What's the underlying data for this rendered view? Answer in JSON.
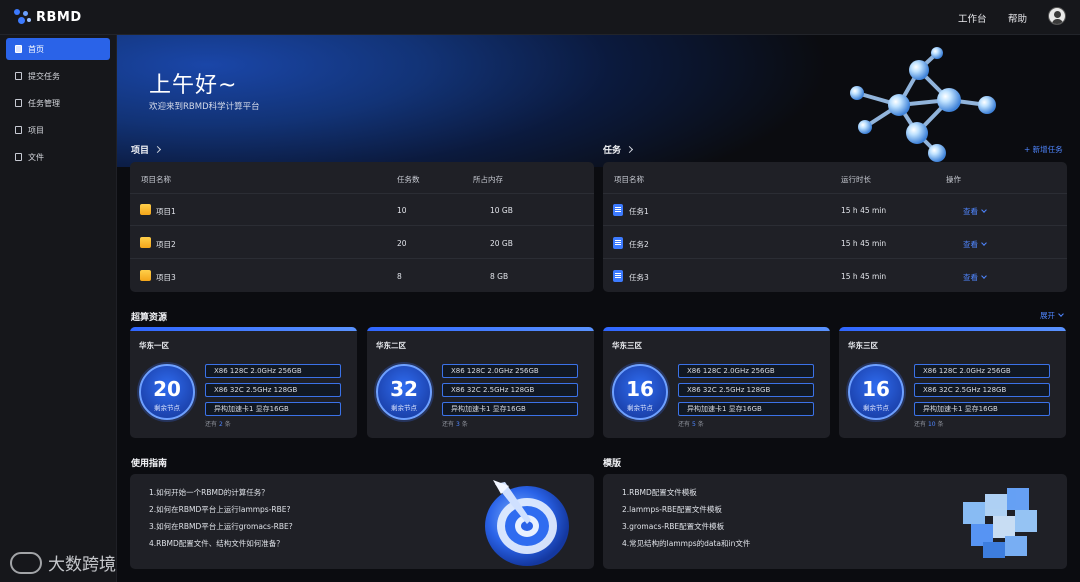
{
  "topbar": {
    "logo": "RBMD",
    "workbench": "工作台",
    "help": "帮助"
  },
  "sidebar": {
    "items": [
      {
        "label": "首页",
        "icon": "home-icon"
      },
      {
        "label": "提交任务",
        "icon": "submit-task-icon"
      },
      {
        "label": "任务管理",
        "icon": "task-manage-icon"
      },
      {
        "label": "项目",
        "icon": "project-icon"
      },
      {
        "label": "文件",
        "icon": "file-icon"
      }
    ]
  },
  "hero": {
    "greeting": "上午好~",
    "subtitle": "欢迎来到RBMD科学计算平台"
  },
  "projects": {
    "title": "项目",
    "columns": [
      "项目名称",
      "任务数",
      "所占内存"
    ],
    "rows": [
      {
        "name": "项目1",
        "tasks": "10",
        "memory": "10 GB"
      },
      {
        "name": "项目2",
        "tasks": "20",
        "memory": "20 GB"
      },
      {
        "name": "项目3",
        "tasks": "8",
        "memory": "8 GB"
      }
    ]
  },
  "tasks": {
    "title": "任务",
    "new_task": "+ 新增任务",
    "columns": [
      "项目名称",
      "运行时长",
      "操作"
    ],
    "rows": [
      {
        "name": "任务1",
        "duration": "15 h 45 min",
        "action": "查看"
      },
      {
        "name": "任务2",
        "duration": "15 h 45 min",
        "action": "查看"
      },
      {
        "name": "任务3",
        "duration": "15 h 45 min",
        "action": "查看"
      }
    ]
  },
  "resources": {
    "title": "超算资源",
    "expand": "展开",
    "node_label": "剩余节点",
    "cards": [
      {
        "region": "华东一区",
        "nodes": "20",
        "specs": [
          "X86 128C 2.0GHz 256GB",
          "X86 32C 2.5GHz 128GB",
          "异构加速卡1 显存16GB"
        ],
        "more_prefix": "还有",
        "more_count": "2",
        "more_suffix": "条"
      },
      {
        "region": "华东二区",
        "nodes": "32",
        "specs": [
          "X86 128C 2.0GHz 256GB",
          "X86 32C 2.5GHz 128GB",
          "异构加速卡1 显存16GB"
        ],
        "more_prefix": "还有",
        "more_count": "3",
        "more_suffix": "条"
      },
      {
        "region": "华东三区",
        "nodes": "16",
        "specs": [
          "X86 128C 2.0GHz 256GB",
          "X86 32C 2.5GHz 128GB",
          "异构加速卡1 显存16GB"
        ],
        "more_prefix": "还有",
        "more_count": "5",
        "more_suffix": "条"
      },
      {
        "region": "华东三区",
        "nodes": "16",
        "specs": [
          "X86 128C 2.0GHz 256GB",
          "X86 32C 2.5GHz 128GB",
          "异构加速卡1 显存16GB"
        ],
        "more_prefix": "还有",
        "more_count": "10",
        "more_suffix": "条"
      }
    ]
  },
  "guide": {
    "title": "使用指南",
    "items": [
      "1.如何开始一个RBMD的计算任务？",
      "2.如何在RBMD平台上运行lammps-RBE?",
      "3.如何在RBMD平台上运行gromacs-RBE?",
      "4.RBMD配置文件、结构文件如何准备？"
    ]
  },
  "templates": {
    "title": "模版",
    "items": [
      "1.RBMD配置文件模板",
      "2.lammps-RBE配置文件模板",
      "3.gromacs-RBE配置文件模板",
      "4.常见结构的lammps的data和in文件"
    ]
  },
  "watermark": "大数跨境",
  "colors": {
    "accent": "#2a63e8",
    "link": "#4f86ff",
    "panel": "#1f2026",
    "background": "#0b0c10"
  }
}
